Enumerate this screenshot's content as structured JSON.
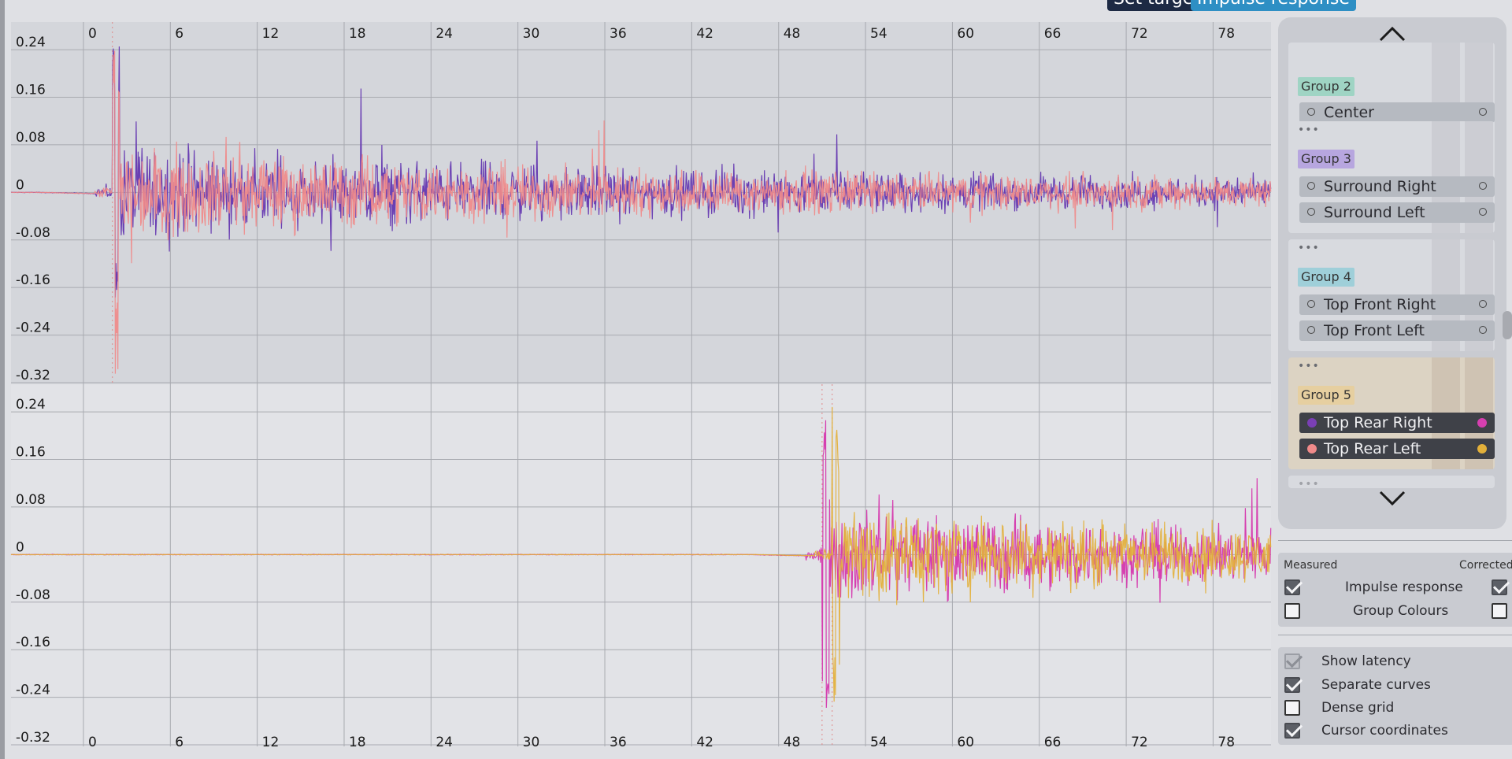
{
  "tabs": {
    "set_target": "Set target",
    "impulse_response": "Impulse response"
  },
  "charts": {
    "top": {
      "x_ticks": [
        "0",
        "6",
        "12",
        "18",
        "24",
        "30",
        "36",
        "42",
        "48",
        "54",
        "60",
        "66",
        "72",
        "78"
      ],
      "y_ticks": [
        "0.24",
        "0.16",
        "0.08",
        "0",
        "-0.08",
        "-0.16",
        "-0.24",
        "-0.32"
      ],
      "series_colors": [
        "#6a3fb3",
        "#f08a8a"
      ]
    },
    "bottom": {
      "x_ticks": [
        "0",
        "6",
        "12",
        "18",
        "24",
        "30",
        "36",
        "42",
        "48",
        "54",
        "60",
        "66",
        "72",
        "78"
      ],
      "y_ticks": [
        "0.24",
        "0.16",
        "0.08",
        "0",
        "-0.08",
        "-0.16",
        "-0.24",
        "-0.32"
      ],
      "series_colors": [
        "#d63fb0",
        "#e3b03a"
      ]
    }
  },
  "chart_data": [
    {
      "type": "line",
      "x_ticks": [
        0,
        6,
        12,
        18,
        24,
        30,
        36,
        42,
        48,
        54,
        60,
        66,
        72,
        78
      ],
      "y_ticks": [
        0.24,
        0.16,
        0.08,
        0,
        -0.08,
        -0.16,
        -0.24,
        -0.32
      ],
      "xlim": [
        -5,
        82
      ],
      "ylim": [
        -0.32,
        0.26
      ],
      "latency_marker_x": 2,
      "series": [
        {
          "color": "#6a3fb3",
          "peak_x": 2,
          "peak_max": 0.25,
          "peak_min": -0.2
        },
        {
          "color": "#f08a8a",
          "peak_x": 2,
          "peak_max": 0.24,
          "peak_min": -0.32
        }
      ]
    },
    {
      "type": "line",
      "x_ticks": [
        0,
        6,
        12,
        18,
        24,
        30,
        36,
        42,
        48,
        54,
        60,
        66,
        72,
        78
      ],
      "y_ticks": [
        0.24,
        0.16,
        0.08,
        0,
        -0.08,
        -0.16,
        -0.24,
        -0.32
      ],
      "xlim": [
        -5,
        82
      ],
      "ylim": [
        -0.32,
        0.26
      ],
      "latency_marker_x": [
        51,
        51.7
      ],
      "series": [
        {
          "color": "#d63fb0",
          "peak_x": 51,
          "peak_max": 0.24,
          "peak_min": -0.28
        },
        {
          "color": "#e3b03a",
          "peak_x": 51.7,
          "peak_max": 0.25,
          "peak_min": -0.3
        }
      ]
    }
  ],
  "groups_panel": {
    "groups": [
      {
        "label": "Group 2",
        "tag_color": "#9fd4c4",
        "channels": [
          {
            "label": "Center",
            "active": false
          }
        ]
      },
      {
        "label": "Group 3",
        "tag_color": "#b7a6df",
        "channels": [
          {
            "label": "Surround Right",
            "active": false
          },
          {
            "label": "Surround Left",
            "active": false
          }
        ]
      },
      {
        "label": "Group 4",
        "tag_color": "#9fcfd9",
        "channels": [
          {
            "label": "Top Front Right",
            "active": false
          },
          {
            "label": "Top Front Left",
            "active": false
          }
        ]
      },
      {
        "label": "Group 5",
        "tag_color": "#e6cfa0",
        "channels": [
          {
            "label": "Top Rear Right",
            "active": true,
            "color_left": "#7a3fb5",
            "color_right": "#d63fb0"
          },
          {
            "label": "Top Rear Left",
            "active": true,
            "color_left": "#f08a8a",
            "color_right": "#e3b03a"
          }
        ]
      }
    ]
  },
  "display_panel": {
    "measured_label": "Measured",
    "corrected_label": "Corrected",
    "rows": [
      {
        "label": "Impulse response",
        "measured": true,
        "corrected": true
      },
      {
        "label": "Group Colours",
        "measured": false,
        "corrected": false
      }
    ]
  },
  "options_panel": {
    "options": [
      {
        "label": "Show latency",
        "checked": true,
        "disabled": true
      },
      {
        "label": "Separate curves",
        "checked": true,
        "disabled": false
      },
      {
        "label": "Dense grid",
        "checked": false,
        "disabled": false
      },
      {
        "label": "Cursor coordinates",
        "checked": true,
        "disabled": false
      }
    ]
  }
}
